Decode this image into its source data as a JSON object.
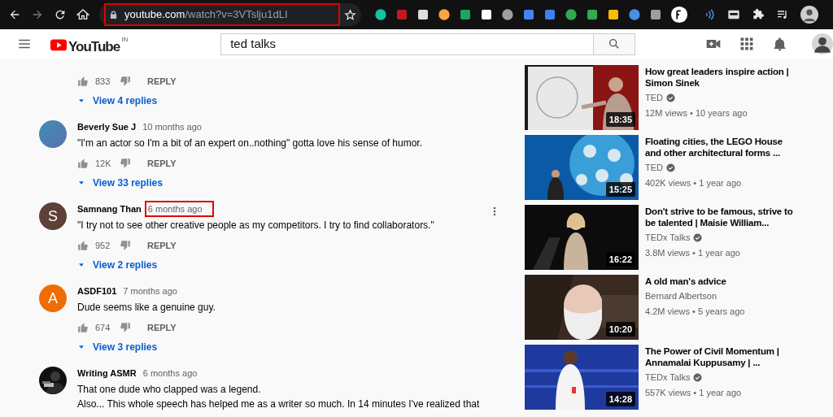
{
  "browser": {
    "url": "youtube.com/watch?v=3VTslju1dLI",
    "url_highlighted": true
  },
  "header": {
    "logo_text": "YouTube",
    "region": "IN",
    "search": {
      "value": "ted talks"
    }
  },
  "comments": [
    {
      "kind": "partial",
      "likes": "833",
      "reply_label": "REPLY",
      "replies": "View 4 replies"
    },
    {
      "kind": "full",
      "author": "Beverly Sue J",
      "time": "10 months ago",
      "time_highlighted": false,
      "text": "\"I'm an actor so I'm a bit of an expert on..nothing\" gotta love his sense of humor.",
      "likes": "12K",
      "reply_label": "REPLY",
      "replies": "View 33 replies",
      "avatar": {
        "kind": "gradient",
        "color": "#3d8fb0"
      },
      "menu": false
    },
    {
      "kind": "full",
      "author": "Samnang Than",
      "time": "6 months ago",
      "time_highlighted": true,
      "text": "\"I try not to see other creative people as my competitors. I try to find collaborators.\"",
      "likes": "952",
      "reply_label": "REPLY",
      "replies": "View 2 replies",
      "avatar": {
        "kind": "letter",
        "letter": "S",
        "color": "#5d4037"
      },
      "menu": true
    },
    {
      "kind": "full",
      "author": "ASDF101",
      "time": "7 months ago",
      "time_highlighted": false,
      "text": "Dude seems like a genuine guy.",
      "likes": "674",
      "reply_label": "REPLY",
      "replies": "View 3 replies",
      "avatar": {
        "kind": "letter",
        "letter": "A",
        "color": "#ef6c00"
      },
      "menu": false
    },
    {
      "kind": "full",
      "author": "Writing ASMR",
      "time": "6 months ago",
      "time_highlighted": false,
      "text": "That one dude who clapped was a legend.",
      "more_text": "Also... This whole speech has helped me as a writer so much. In 14 minutes I've realized that",
      "menu": false
    }
  ],
  "sidebar": [
    {
      "title": "How great leaders inspire action | Simon Sinek",
      "channel": "TED",
      "verified": true,
      "meta": "12M views • 10 years ago",
      "duration": "18:35"
    },
    {
      "title": "Floating cities, the LEGO House and other architectural forms ...",
      "channel": "TED",
      "verified": true,
      "meta": "402K views • 1 year ago",
      "duration": "15:25"
    },
    {
      "title": "Don't strive to be famous, strive to be talented | Maisie William...",
      "channel": "TEDx Talks",
      "verified": true,
      "meta": "3.8M views • 1 year ago",
      "duration": "16:22"
    },
    {
      "title": "A old man's advice",
      "channel": "Bernard Albertson",
      "verified": false,
      "meta": "4.2M views • 5 years ago",
      "duration": "10:20"
    },
    {
      "title": "The Power of Civil Momentum | Annamalai Kuppusamy | ...",
      "channel": "TEDx Talks",
      "verified": true,
      "meta": "557K views • 1 year ago",
      "duration": "14:28"
    }
  ]
}
